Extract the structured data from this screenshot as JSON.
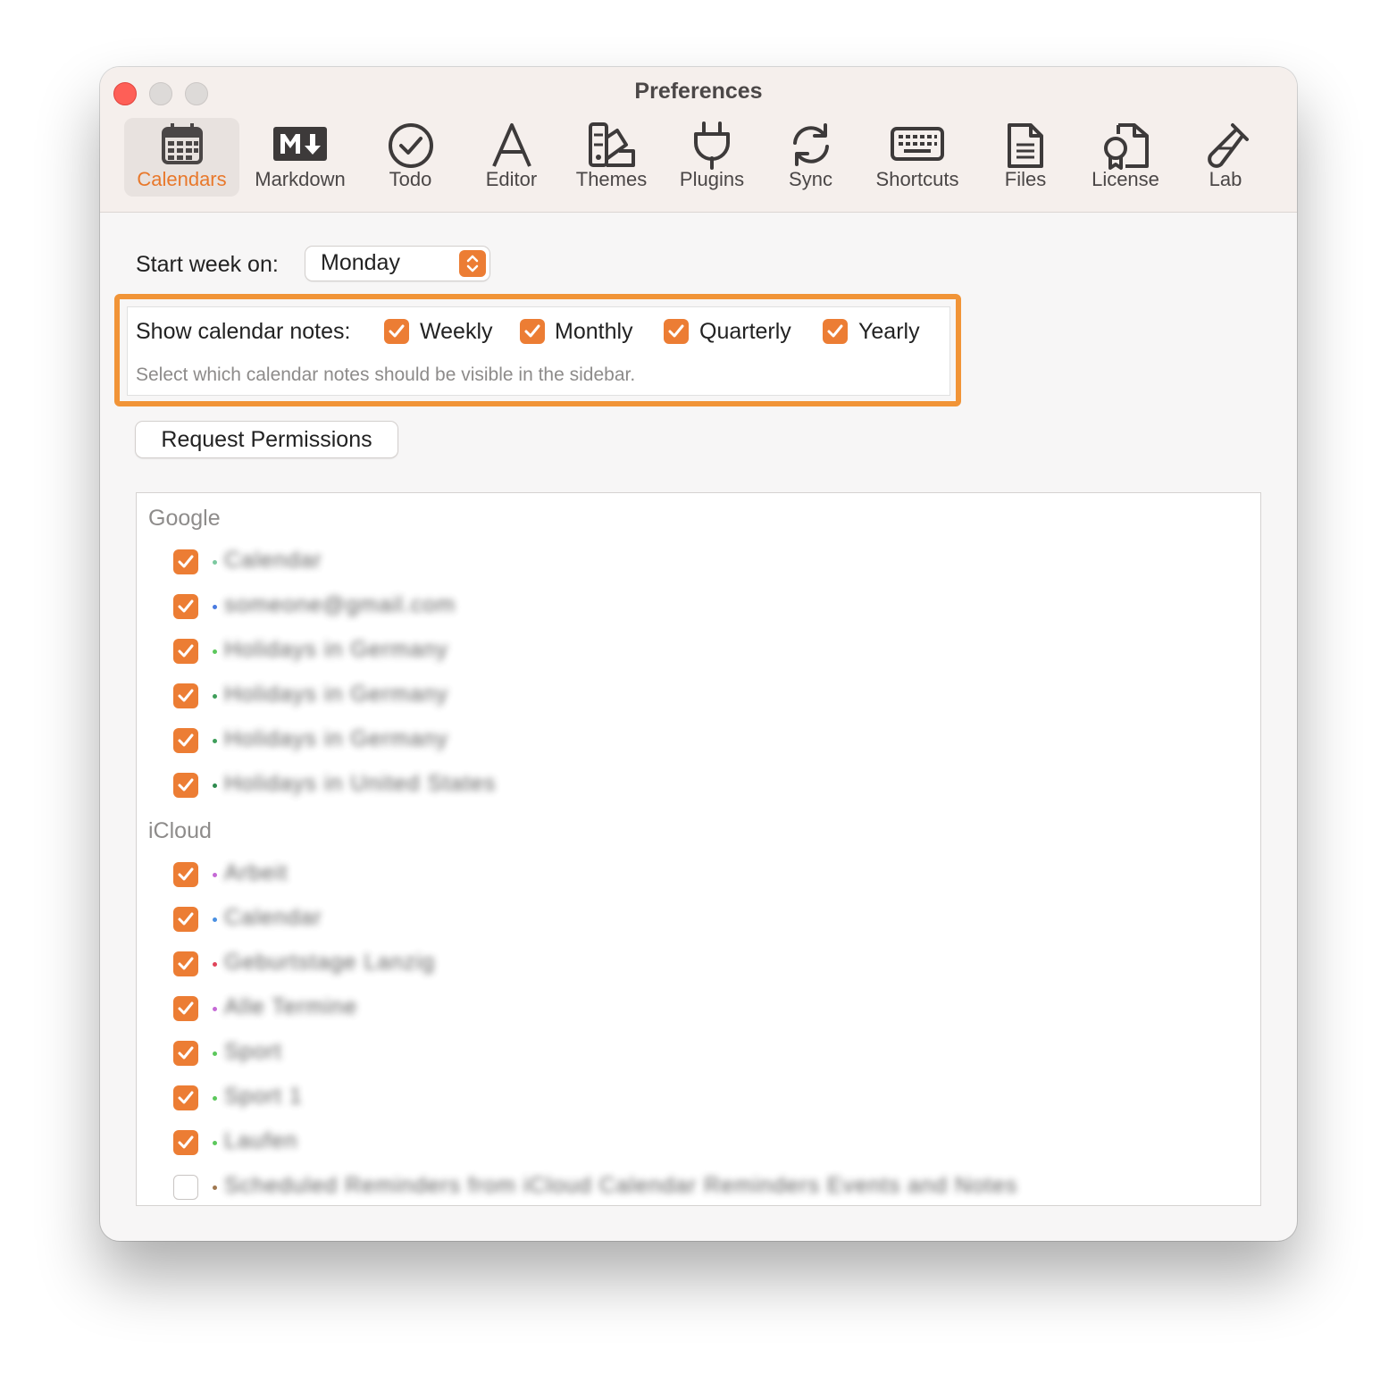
{
  "window": {
    "title": "Preferences"
  },
  "toolbar": {
    "tabs": [
      {
        "label": "Calendars",
        "icon": "calendar-icon",
        "active": true
      },
      {
        "label": "Markdown",
        "icon": "markdown-icon"
      },
      {
        "label": "Todo",
        "icon": "checkmark-circle-icon"
      },
      {
        "label": "Editor",
        "icon": "letter-a-icon"
      },
      {
        "label": "Themes",
        "icon": "swatches-icon"
      },
      {
        "label": "Plugins",
        "icon": "plug-icon"
      },
      {
        "label": "Sync",
        "icon": "sync-icon"
      },
      {
        "label": "Shortcuts",
        "icon": "keyboard-icon"
      },
      {
        "label": "Files",
        "icon": "document-icon"
      },
      {
        "label": "License",
        "icon": "certificate-icon"
      },
      {
        "label": "Lab",
        "icon": "test-tube-icon"
      }
    ]
  },
  "settings": {
    "start_week_label": "Start week on:",
    "start_week_value": "Monday",
    "calendar_notes_label": "Show calendar notes:",
    "calendar_notes_options": [
      {
        "label": "Weekly",
        "checked": true
      },
      {
        "label": "Monthly",
        "checked": true
      },
      {
        "label": "Quarterly",
        "checked": true
      },
      {
        "label": "Yearly",
        "checked": true
      }
    ],
    "calendar_notes_hint": "Select which calendar notes should be visible in the sidebar.",
    "request_permissions_label": "Request Permissions"
  },
  "calendars": {
    "groups": [
      {
        "name": "Google",
        "items": [
          {
            "name": "Calendar",
            "color": "#7cc9a0",
            "checked": true
          },
          {
            "name": "someone@gmail.com",
            "color": "#4a7be0",
            "checked": true
          },
          {
            "name": "Holidays in Germany",
            "color": "#5cc85c",
            "checked": true
          },
          {
            "name": "Holidays in Germany",
            "color": "#3e9e5a",
            "checked": true
          },
          {
            "name": "Holidays in Germany",
            "color": "#3e9e5a",
            "checked": true
          },
          {
            "name": "Holidays in United States",
            "color": "#2e8b4e",
            "checked": true
          }
        ]
      },
      {
        "name": "iCloud",
        "items": [
          {
            "name": "Arbeit",
            "color": "#c56ad6",
            "checked": true
          },
          {
            "name": "Calendar",
            "color": "#4a90e2",
            "checked": true
          },
          {
            "name": "Geburtstage Lanzig",
            "color": "#e0455a",
            "checked": true
          },
          {
            "name": "Alle Termine",
            "color": "#c56ad6",
            "checked": true
          },
          {
            "name": "Sport",
            "color": "#5cc85c",
            "checked": true
          },
          {
            "name": "Sport 1",
            "color": "#5cc85c",
            "checked": true
          },
          {
            "name": "Laufen",
            "color": "#5cc85c",
            "checked": true
          },
          {
            "name": "Scheduled Reminders from iCloud Calendar Reminders Events and Notes",
            "color": "#a07850",
            "checked": false
          }
        ]
      }
    ]
  },
  "colors": {
    "accent": "#ec7d34",
    "highlight": "#f19437"
  }
}
